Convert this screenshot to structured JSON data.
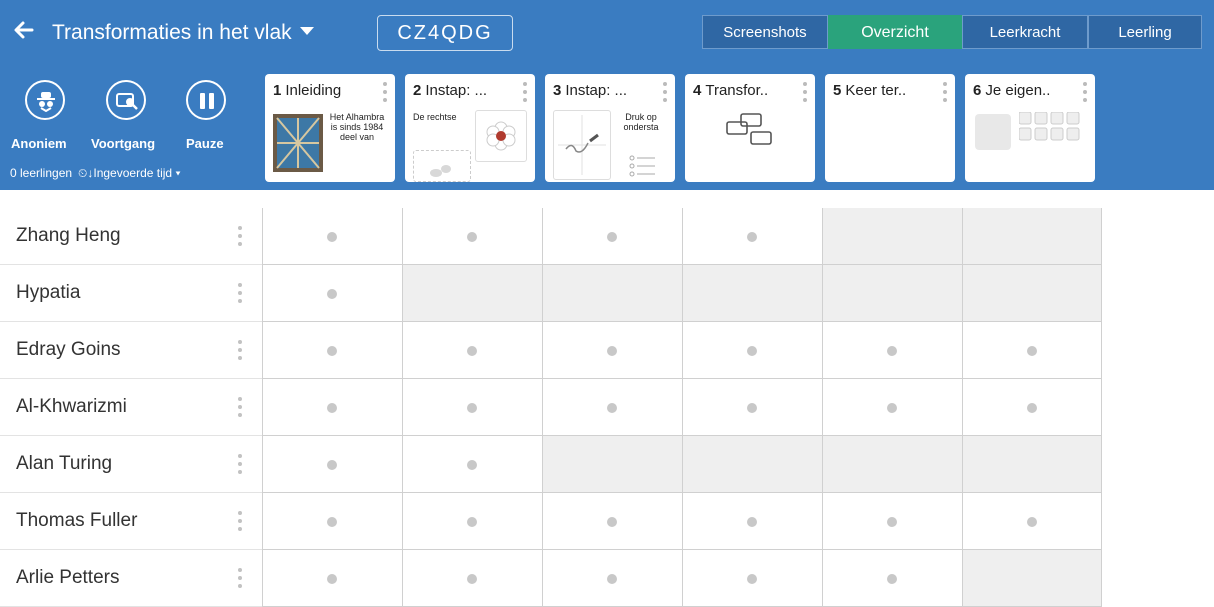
{
  "header": {
    "title": "Transformaties in het vlak",
    "code": "CZ4QDG",
    "tabs": [
      {
        "label": "Screenshots",
        "active": false
      },
      {
        "label": "Overzicht",
        "active": true
      },
      {
        "label": "Leerkracht",
        "active": false
      },
      {
        "label": "Leerling",
        "active": false
      }
    ]
  },
  "controls": {
    "anoniem_label": "Anoniem",
    "voortgang_label": "Voortgang",
    "pauze_label": "Pauze",
    "student_count": "0 leerlingen",
    "time_dropdown": "Ingevoerde tijd"
  },
  "slides": [
    {
      "number": "1",
      "title": "Inleiding",
      "thumb_text": "Het Alhambra is sinds 1984 deel van"
    },
    {
      "number": "2",
      "title": "Instap: ...",
      "thumb_text": "De rechtse"
    },
    {
      "number": "3",
      "title": "Instap: ...",
      "thumb_text": "Druk op ondersta"
    },
    {
      "number": "4",
      "title": "Transfor..",
      "thumb_text": ""
    },
    {
      "number": "5",
      "title": "Keer ter..",
      "thumb_text": ""
    },
    {
      "number": "6",
      "title": "Je eigen..",
      "thumb_text": ""
    }
  ],
  "students": [
    {
      "name": "Zhang Heng",
      "cells": [
        "dot",
        "dot",
        "dot",
        "dot",
        "off",
        "off"
      ]
    },
    {
      "name": "Hypatia",
      "cells": [
        "dot",
        "off",
        "off",
        "off",
        "off",
        "off"
      ]
    },
    {
      "name": "Edray Goins",
      "cells": [
        "dot",
        "dot",
        "dot",
        "dot",
        "dot",
        "dot"
      ]
    },
    {
      "name": "Al-Khwarizmi",
      "cells": [
        "dot",
        "dot",
        "dot",
        "dot",
        "dot",
        "dot"
      ]
    },
    {
      "name": "Alan Turing",
      "cells": [
        "dot",
        "dot",
        "off",
        "off",
        "off",
        "off"
      ]
    },
    {
      "name": "Thomas Fuller",
      "cells": [
        "dot",
        "dot",
        "dot",
        "dot",
        "dot",
        "dot"
      ]
    },
    {
      "name": "Arlie Petters",
      "cells": [
        "dot",
        "dot",
        "dot",
        "dot",
        "dot",
        "off"
      ]
    }
  ],
  "colors": {
    "header_bg": "#3a7cc1",
    "tab_bg": "#2f67a4",
    "active_tab_bg": "#2aa37c",
    "inactive_cell": "#efefef",
    "dot": "#c8c8c8"
  }
}
